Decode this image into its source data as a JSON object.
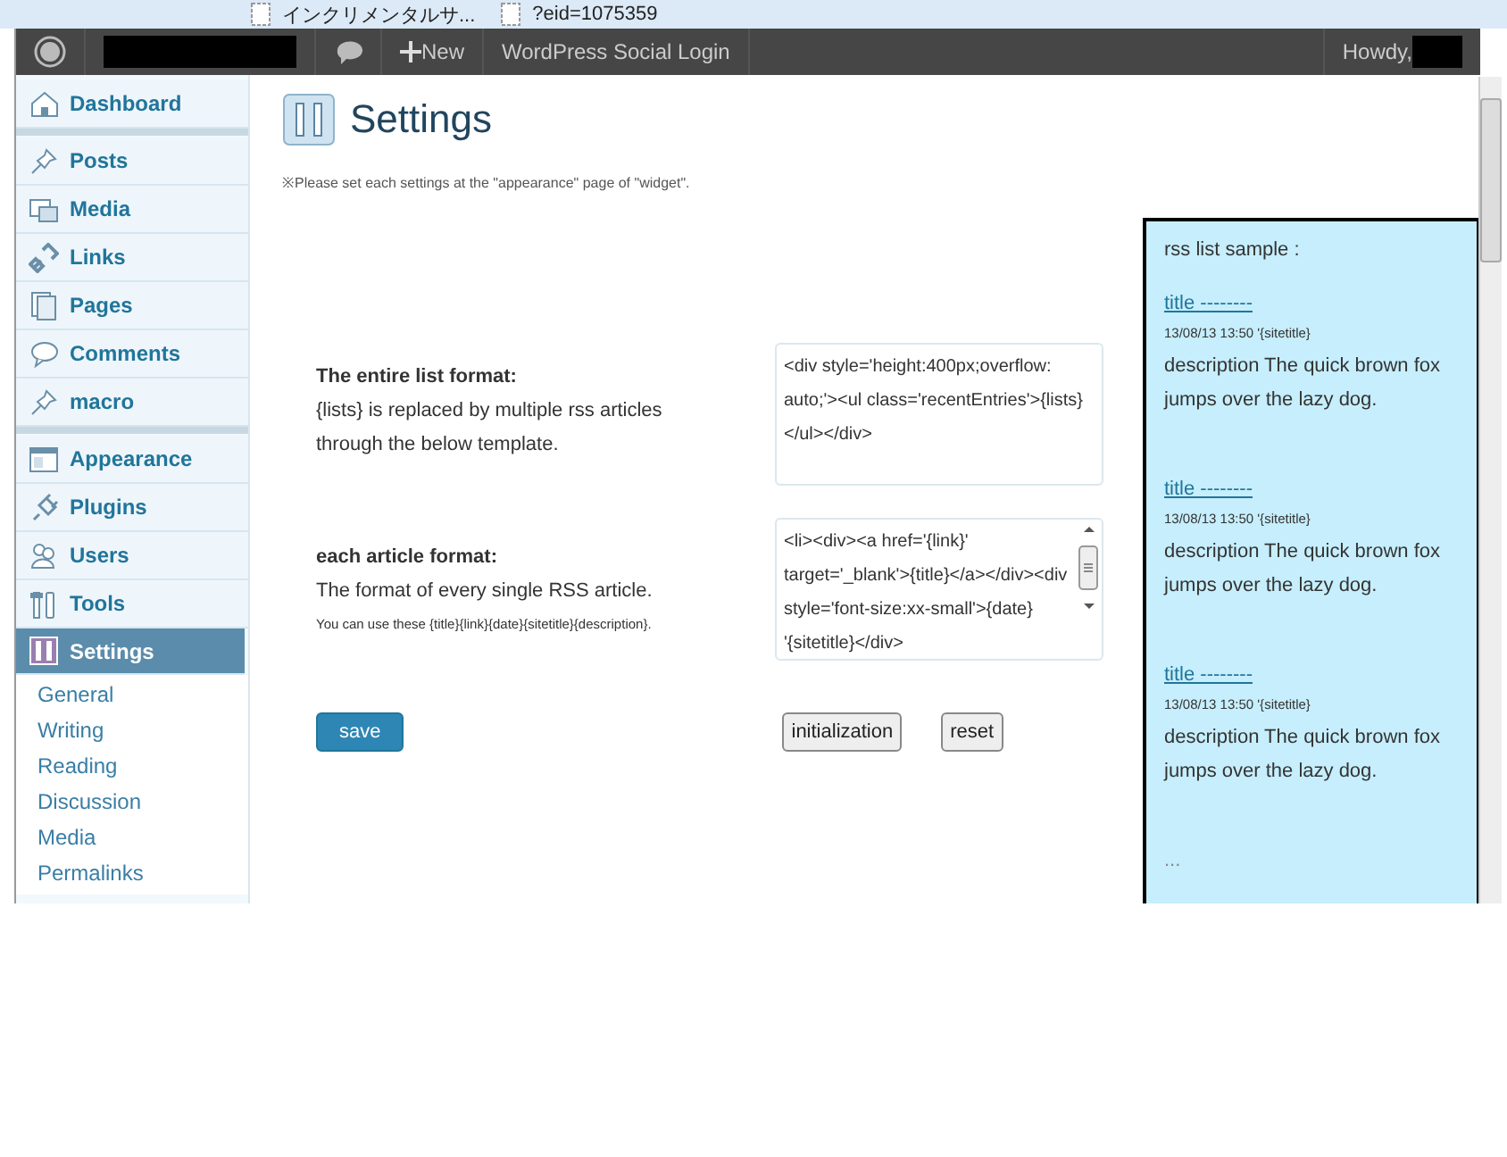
{
  "browser_tabs": [
    {
      "title": "インクリメンタルサ..."
    },
    {
      "title": "?eid=1075359"
    }
  ],
  "admin_bar": {
    "new_label": "New",
    "plugin_link": "WordPress Social Login",
    "greeting": "Howdy,"
  },
  "sidebar": {
    "items": [
      {
        "kind": "menu",
        "label": "Dashboard",
        "selected": false
      },
      {
        "kind": "separator"
      },
      {
        "kind": "menu",
        "label": "Posts",
        "selected": false
      },
      {
        "kind": "menu",
        "label": "Media",
        "selected": false
      },
      {
        "kind": "menu",
        "label": "Links",
        "selected": false
      },
      {
        "kind": "menu",
        "label": "Pages",
        "selected": false
      },
      {
        "kind": "menu",
        "label": "Comments",
        "selected": false
      },
      {
        "kind": "menu",
        "label": "macro",
        "selected": false
      },
      {
        "kind": "separator"
      },
      {
        "kind": "menu",
        "label": "Appearance",
        "selected": false
      },
      {
        "kind": "menu",
        "label": "Plugins",
        "selected": false
      },
      {
        "kind": "menu",
        "label": "Users",
        "selected": false
      },
      {
        "kind": "menu",
        "label": "Tools",
        "selected": false
      },
      {
        "kind": "menu",
        "label": "Settings",
        "selected": true,
        "children": [
          {
            "label": "General"
          },
          {
            "label": "Writing"
          },
          {
            "label": "Reading"
          },
          {
            "label": "Discussion"
          },
          {
            "label": "Media"
          },
          {
            "label": "Permalinks"
          }
        ]
      }
    ]
  },
  "page": {
    "title": "Settings",
    "note": "※Please set each settings at the \"appearance\" page of \"widget\".",
    "fields": [
      {
        "label": "The entire list format:",
        "description": "{lists} is replaced by multiple rss articles through the below template.",
        "value": "<div style='height:400px;overflow: auto;'><ul class='recentEntries'>{lists}</ul></div>",
        "scrollable": false
      },
      {
        "label": "each article format:",
        "description": "The format of every single RSS article.",
        "hint": "You can use these {title}{link}{date}{sitetitle}{description}.",
        "value": "<li><div><a href='{link}' target='_blank'>{title}</a></div><div style='font-size:xx-small'>{date} '{sitetitle}</div>",
        "scrollable": true
      }
    ],
    "buttons": [
      {
        "kind": "primary",
        "label": "save"
      },
      {
        "kind": "secondary",
        "label": "initialization"
      },
      {
        "kind": "secondary",
        "label": "reset"
      }
    ]
  },
  "preview": {
    "heading": "rss list sample :",
    "entries": [
      {
        "title": "title --------",
        "meta": "13/08/13 13:50 '{sitetitle}",
        "description": "description The quick brown fox jumps over the lazy dog."
      },
      {
        "title": "title --------",
        "meta": "13/08/13 13:50 '{sitetitle}",
        "description": "description The quick brown fox jumps over the lazy dog."
      },
      {
        "title": "title --------",
        "meta": "13/08/13 13:50 '{sitetitle}",
        "description": "description The quick brown fox jumps over the lazy dog."
      }
    ],
    "more": "..."
  }
}
